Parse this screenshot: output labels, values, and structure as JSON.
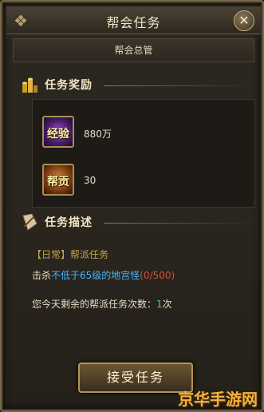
{
  "window": {
    "title": "帮会任务",
    "close_glyph": "✕"
  },
  "npc": {
    "name": "帮会总管"
  },
  "rewards_section": {
    "label": "任务奖励",
    "icon": "coins-icon"
  },
  "rewards": [
    {
      "icon_text": "经验",
      "value": "880万",
      "icon": "experience-icon"
    },
    {
      "icon_text": "帮贡",
      "value": "30",
      "icon": "guild-contribution-icon"
    }
  ],
  "desc_section": {
    "label": "任务描述",
    "icon": "scroll-icon"
  },
  "description": {
    "category_prefix": "【日常】",
    "category_name": "帮派任务",
    "objective_verb": "击杀",
    "objective_target": "不低于65级的地宫怪",
    "objective_progress": "(0/500)",
    "remaining_prefix": "您今天剩余的帮派任务次数：",
    "remaining_count": "1",
    "remaining_suffix": "次"
  },
  "accept_button": {
    "label": "接受任务"
  },
  "watermark": {
    "text": "京华手游网"
  },
  "colors": {
    "gold": "#c9a24a",
    "cyan": "#46b4ff",
    "green": "#3fe43f",
    "red": "#d0503c"
  }
}
